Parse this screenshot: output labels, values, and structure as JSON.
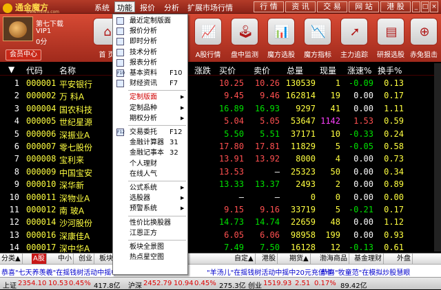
{
  "app": {
    "logo_text": "通金魔方",
    "logo_sub": "www.mfniu.com"
  },
  "menubar": [
    "系统",
    "功能",
    "报价",
    "分析",
    "扩展市场行情"
  ],
  "right_buttons": [
    "行 情",
    "资 讯",
    "交 易",
    "网 站",
    "港 股"
  ],
  "user": {
    "level": "第七下载",
    "vip": "VIP1",
    "points": "0分",
    "member_button": "会员中心"
  },
  "toolbar": [
    {
      "label": "首 页",
      "icon": "home-icon",
      "glyph": "⌂"
    },
    {
      "label": "A股行情",
      "icon": "stock-chart-icon",
      "glyph": "📈"
    },
    {
      "label": "盘中监测",
      "icon": "joystick-icon",
      "glyph": "🕹"
    },
    {
      "label": "魔方选股",
      "icon": "bar-chart-icon",
      "glyph": "📊"
    },
    {
      "label": "魔方指标",
      "icon": "line-chart-icon",
      "glyph": "📉"
    },
    {
      "label": "主力追踪",
      "icon": "trend-icon",
      "glyph": "➚"
    },
    {
      "label": "研报选股",
      "icon": "report-chart-icon",
      "glyph": "▤"
    },
    {
      "label": "赤兔狙击",
      "icon": "target-icon",
      "glyph": "⊕"
    }
  ],
  "table": {
    "headers": {
      "idx": "▼",
      "code": "代码",
      "name": "名称",
      "change": "涨跌",
      "bid": "买价",
      "ask": "卖价",
      "volume": "总量",
      "cur": "现量",
      "speed": "涨速%",
      "turnover": "换手%"
    },
    "rows": [
      {
        "i": "1",
        "code": "000001",
        "name": "平安银行",
        "change": "",
        "bid": "10.25",
        "ask": "10.26",
        "volume": "130539",
        "cur": "1",
        "speed": "-0.09",
        "turnover": "0.13",
        "color": "#ff5050"
      },
      {
        "i": "2",
        "code": "000002",
        "name": "万  科A",
        "change": "",
        "bid": "9.45",
        "ask": "9.46",
        "volume": "162814",
        "cur": "19",
        "speed": "0.00",
        "turnover": "0.17",
        "color": "#ff5050"
      },
      {
        "i": "3",
        "code": "000004",
        "name": "国农科技",
        "change": "",
        "bid": "16.89",
        "ask": "16.93",
        "volume": "9297",
        "cur": "41",
        "speed": "0.00",
        "turnover": "1.11",
        "color": "#00e000"
      },
      {
        "i": "4",
        "code": "000005",
        "name": "世纪星源",
        "change": "",
        "bid": "5.04",
        "ask": "5.05",
        "volume": "53647",
        "cur": "1142",
        "speed": "1.53",
        "turnover": "0.59",
        "color": "#ff5050"
      },
      {
        "i": "5",
        "code": "000006",
        "name": "深振业A",
        "change": "",
        "bid": "5.50",
        "ask": "5.51",
        "volume": "37171",
        "cur": "10",
        "speed": "-0.33",
        "turnover": "0.24",
        "color": "#00e000"
      },
      {
        "i": "6",
        "code": "000007",
        "name": "零七股份",
        "change": "",
        "bid": "17.80",
        "ask": "17.81",
        "volume": "11829",
        "cur": "5",
        "speed": "-0.05",
        "turnover": "0.58",
        "color": "#ff5050"
      },
      {
        "i": "7",
        "code": "000008",
        "name": "宝利来",
        "change": "",
        "bid": "13.91",
        "ask": "13.92",
        "volume": "8000",
        "cur": "4",
        "speed": "0.00",
        "turnover": "0.73",
        "color": "#ff5050"
      },
      {
        "i": "8",
        "code": "000009",
        "name": "中国宝安",
        "change": "",
        "bid": "13.53",
        "ask": "–",
        "volume": "25323",
        "cur": "50",
        "speed": "0.00",
        "turnover": "0.34",
        "color": "#ff5050"
      },
      {
        "i": "9",
        "code": "000010",
        "name": "深华新",
        "change": "",
        "bid": "13.33",
        "ask": "13.37",
        "volume": "2493",
        "cur": "2",
        "speed": "0.00",
        "turnover": "0.89",
        "color": "#00e000"
      },
      {
        "i": "10",
        "code": "000011",
        "name": "深物业A",
        "change": "",
        "bid": "–",
        "ask": "–",
        "volume": "0",
        "cur": "0",
        "speed": "0.00",
        "turnover": "0.00",
        "color": "#00e000"
      },
      {
        "i": "11",
        "code": "000012",
        "name": "南  玻A",
        "change": "",
        "bid": "9.15",
        "ask": "9.16",
        "volume": "33719",
        "cur": "5",
        "speed": "-0.21",
        "turnover": "0.17",
        "color": "#ff5050"
      },
      {
        "i": "12",
        "code": "000014",
        "name": "沙河股份",
        "change": "",
        "bid": "14.73",
        "ask": "14.74",
        "volume": "22659",
        "cur": "48",
        "speed": "0.00",
        "turnover": "1.12",
        "color": "#00e000"
      },
      {
        "i": "13",
        "code": "000016",
        "name": "深康佳A",
        "change": "",
        "bid": "6.05",
        "ask": "6.06",
        "volume": "98958",
        "cur": "199",
        "speed": "0.00",
        "turnover": "0.93",
        "color": "#ff5050"
      },
      {
        "i": "14",
        "code": "000017",
        "name": "深中华A",
        "change": "",
        "bid": "7.49",
        "ask": "7.50",
        "volume": "16128",
        "cur": "12",
        "speed": "-0.13",
        "turnover": "0.61",
        "color": "#00e000"
      }
    ]
  },
  "func_menu": [
    {
      "label": "最近定制版面",
      "icon": "layout-icon",
      "red": false
    },
    {
      "label": "报价分析",
      "icon": "quote-table-icon",
      "red": false
    },
    {
      "label": "即时分析",
      "icon": "realtime-chart-icon",
      "red": false
    },
    {
      "label": "技术分析",
      "icon": "kline-icon",
      "red": false
    },
    {
      "label": "报表分析",
      "icon": "report-table-icon",
      "red": false
    },
    {
      "label": "基本资料",
      "shortcut": "F10",
      "icon": "f10-icon",
      "red": false
    },
    {
      "label": "财经资讯",
      "shortcut": "F7",
      "icon": "news-icon",
      "red": false
    },
    {
      "sep": true
    },
    {
      "label": "定制版面",
      "arrow": true,
      "red": true
    },
    {
      "label": "定制品种",
      "arrow": true,
      "red": false
    },
    {
      "label": "期权分析",
      "arrow": true,
      "red": false
    },
    {
      "sep": true
    },
    {
      "label": "交易委托",
      "shortcut": "F12",
      "icon": "f12-icon",
      "red": false
    },
    {
      "label": "金融计算器",
      "shortcut": "31",
      "red": false
    },
    {
      "label": "金融记事本",
      "shortcut": "32",
      "red": false
    },
    {
      "label": "个人理财",
      "red": false
    },
    {
      "label": "在线人气",
      "red": false
    },
    {
      "sep": true
    },
    {
      "label": "公式系统",
      "arrow": true,
      "red": false
    },
    {
      "label": "选股器",
      "arrow": true,
      "red": false
    },
    {
      "label": "预警系统",
      "arrow": true,
      "red": false
    },
    {
      "sep": true
    },
    {
      "label": "性价比换股器",
      "red": false
    },
    {
      "label": "江恩正方",
      "red": false
    },
    {
      "sep": true
    },
    {
      "label": "板块全景图",
      "red": false
    },
    {
      "label": "热点星空图",
      "red": false
    }
  ],
  "tabs": [
    "分类▲",
    "A股",
    "中小",
    "创业",
    "板块",
    "自定▲",
    "港股",
    "期货▲",
    "渤海商品",
    "基金理财",
    "外盘"
  ],
  "ticker": {
    "left": "恭喜\"七天养羡羲\"在摇钱树活动中摇中",
    "mid": "\"羊汤儿\"在摇钱树活动中摇中20元充值卡!",
    "right": "恭喜\"牧童范\"在模拟炒股慧眼"
  },
  "status": {
    "sh_label": "上证",
    "sh_value": "2354.10",
    "sh_change": "10.53",
    "sh_pct": "0.45%",
    "sh_amt": "417.8亿",
    "hs_label": "沪深",
    "hs_value": "2452.79",
    "hs_change": "10.94",
    "hs_pct": "0.45%",
    "hs_amt": "275.3亿",
    "cy_label": "创业",
    "cy_value": "1519.93",
    "cy_change": "2.51",
    "cy_pct": "0.17%",
    "cy_amt": "89.42亿"
  },
  "colors": {
    "up": "#ff5050",
    "down": "#00e000",
    "header_bg": "#b33b28",
    "accent": "#c81818"
  }
}
